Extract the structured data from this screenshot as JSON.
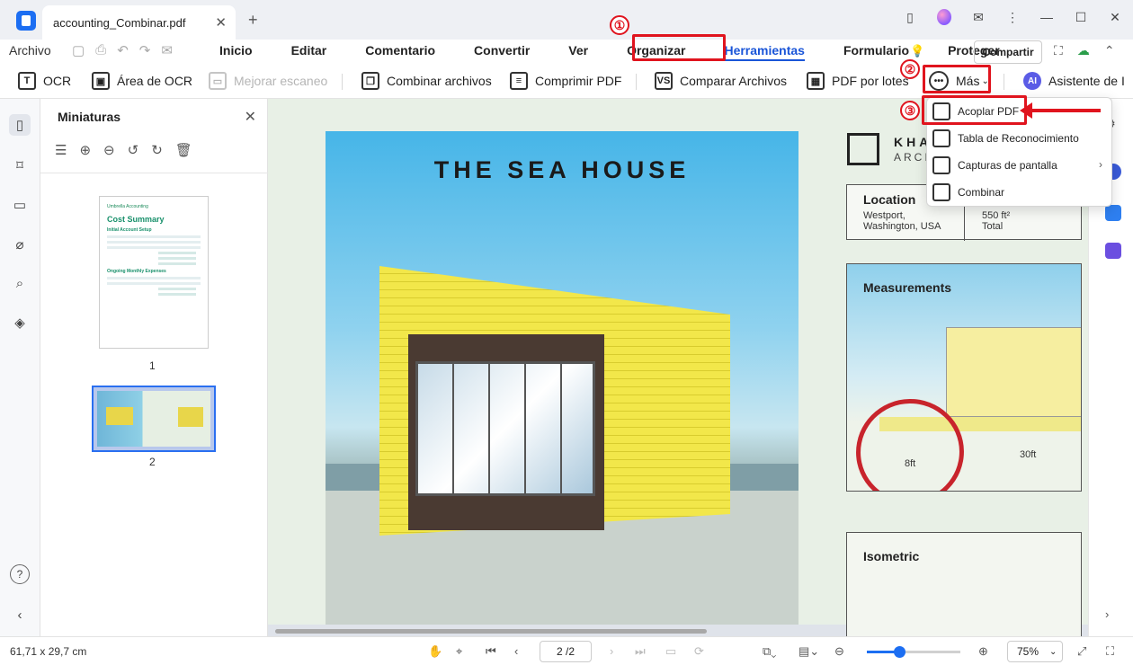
{
  "window": {
    "tab_title": "accounting_Combinar.pdf",
    "tab_close": "✕",
    "new_tab": "+"
  },
  "menubar": {
    "file_label": "Archivo",
    "items": [
      "Inicio",
      "Editar",
      "Comentario",
      "Convertir",
      "Ver",
      "Organizar",
      "Herramientas",
      "Formulario",
      "Proteger"
    ],
    "active_item": "Herramientas",
    "share_label": "Compartir"
  },
  "toolbar": {
    "ocr": "OCR",
    "ocr_area": "Área de OCR",
    "improve_scan": "Mejorar escaneo",
    "combine_files": "Combinar archivos",
    "compress_pdf": "Comprimir PDF",
    "compare_files": "Comparar Archivos",
    "batch_pdf": "PDF por lotes",
    "more": "Más",
    "ai_assistant": "Asistente de I"
  },
  "dropdown": {
    "items": [
      {
        "label": "Acoplar PDF",
        "icon": "flatten-icon"
      },
      {
        "label": "Tabla de Reconocimiento",
        "icon": "table-recognition-icon"
      },
      {
        "label": "Capturas de pantalla",
        "icon": "screenshot-icon",
        "has_submenu": true
      },
      {
        "label": "Combinar",
        "icon": "combine-icon"
      }
    ]
  },
  "annotations": {
    "steps": [
      "①",
      "②",
      "③"
    ],
    "color": "#e0141e"
  },
  "thumbnails": {
    "title": "Miniaturas",
    "close": "✕",
    "pages": [
      {
        "number": "1",
        "brand": "Umbrella Accounting",
        "title": "Cost Summary",
        "section1": "Initial Account Setup",
        "section2": "Ongoing Monthly Expenses"
      },
      {
        "number": "2"
      }
    ]
  },
  "document": {
    "poster_title": "THE SEA HOUSE",
    "logo_text": "KHA",
    "logo_sub": "ARCI",
    "location": {
      "title": "Location",
      "line1": "Westport,",
      "line2": "Washington, USA",
      "area": "550 ft²",
      "area_label": "Total"
    },
    "measurements": {
      "title": "Measurements",
      "label_a": "8ft",
      "label_b": "30ft"
    },
    "isometric": {
      "title": "Isometric"
    }
  },
  "statusbar": {
    "dimensions": "61,71 x 29,7 cm",
    "page_input": "2 /2",
    "zoom": "75%",
    "zoom_fraction": 0.35
  },
  "colors": {
    "accent": "#1c6ef2",
    "active_menu": "#1a55d8",
    "annotation": "#e0141e"
  }
}
